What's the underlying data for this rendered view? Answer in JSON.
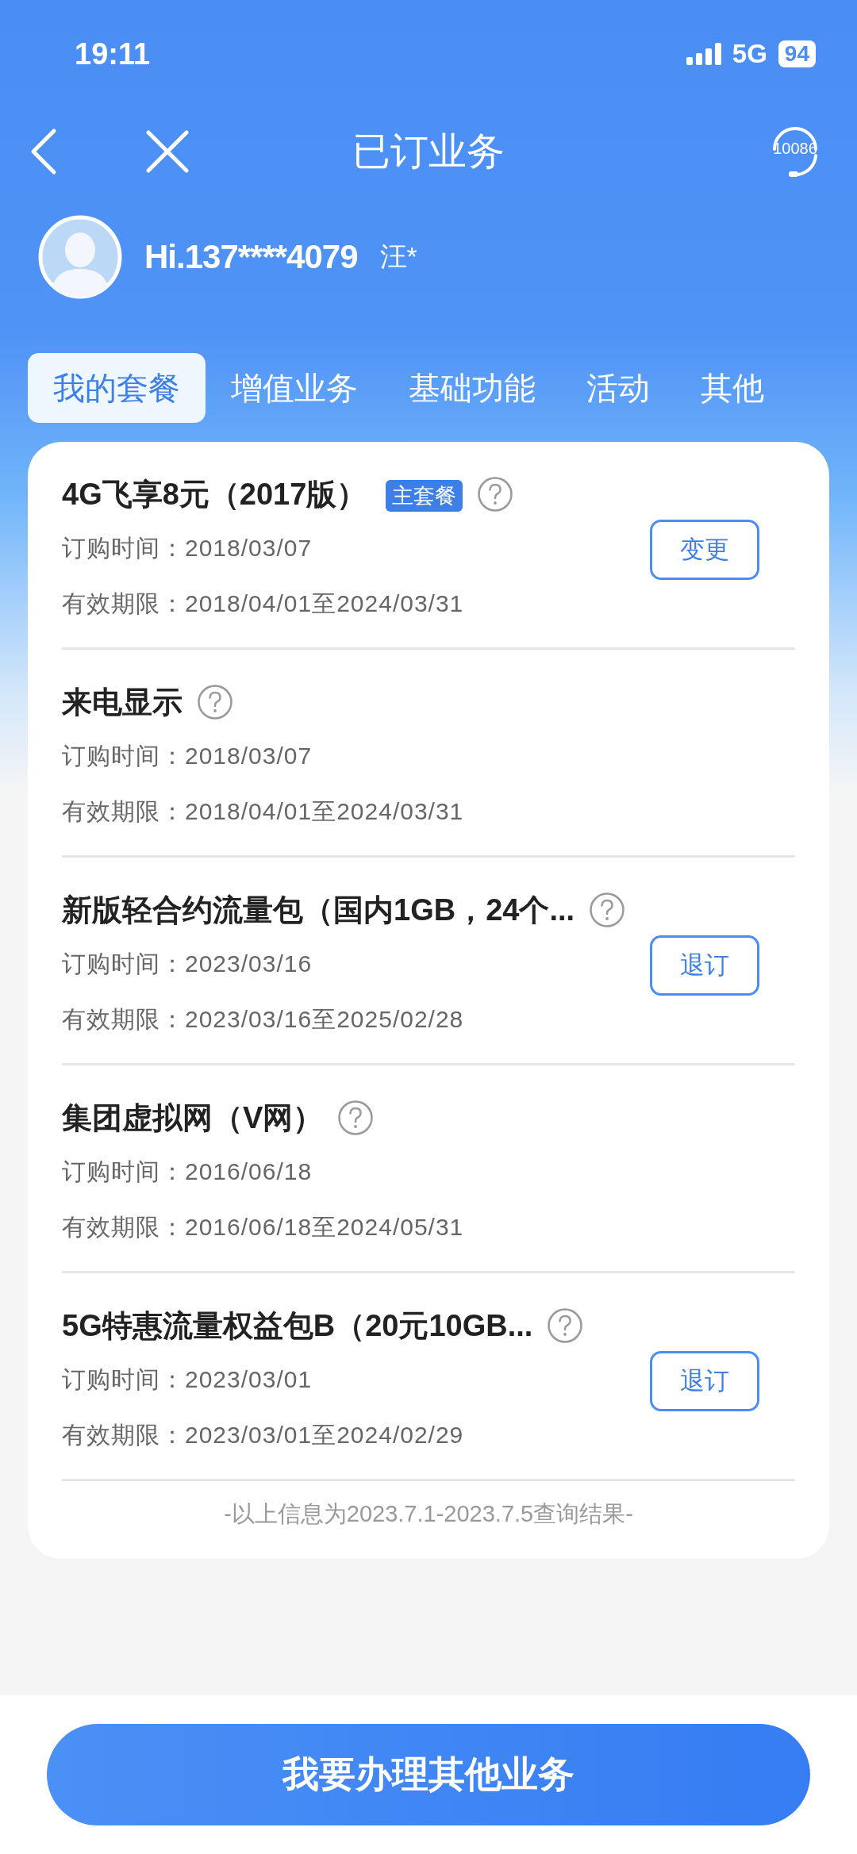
{
  "status_bar": {
    "time": "19:11",
    "network": "5G",
    "battery": "94"
  },
  "nav": {
    "title": "已订业务",
    "service_label": "10086"
  },
  "user": {
    "greeting": "Hi.137****4079",
    "name": "汪*"
  },
  "tabs": [
    {
      "label": "我的套餐",
      "selected": true
    },
    {
      "label": "增值业务",
      "selected": false
    },
    {
      "label": "基础功能",
      "selected": false
    },
    {
      "label": "活动",
      "selected": false
    },
    {
      "label": "其他",
      "selected": false
    }
  ],
  "services": [
    {
      "title": "4G飞享8元（2017版）",
      "badge": "主套餐",
      "order_label": "订购时间：",
      "order_date": "2018/03/07",
      "valid_label": "有效期限：",
      "valid_period": "2018/04/01至2024/03/31",
      "button": "变更"
    },
    {
      "title": "来电显示",
      "order_label": "订购时间：",
      "order_date": "2018/03/07",
      "valid_label": "有效期限：",
      "valid_period": "2018/04/01至2024/03/31"
    },
    {
      "title": "新版轻合约流量包（国内1GB，24个...",
      "order_label": "订购时间：",
      "order_date": "2023/03/16",
      "valid_label": "有效期限：",
      "valid_period": "2023/03/16至2025/02/28",
      "button": "退订"
    },
    {
      "title": "集团虚拟网（V网）",
      "order_label": "订购时间：",
      "order_date": "2016/06/18",
      "valid_label": "有效期限：",
      "valid_period": "2016/06/18至2024/05/31"
    },
    {
      "title": "5G特惠流量权益包B（20元10GB...",
      "order_label": "订购时间：",
      "order_date": "2023/03/01",
      "valid_label": "有效期限：",
      "valid_period": "2023/03/01至2024/02/29",
      "button": "退订"
    }
  ],
  "footer_note": "-以上信息为2023.7.1-2023.7.5查询结果-",
  "main_button": "我要办理其他业务"
}
